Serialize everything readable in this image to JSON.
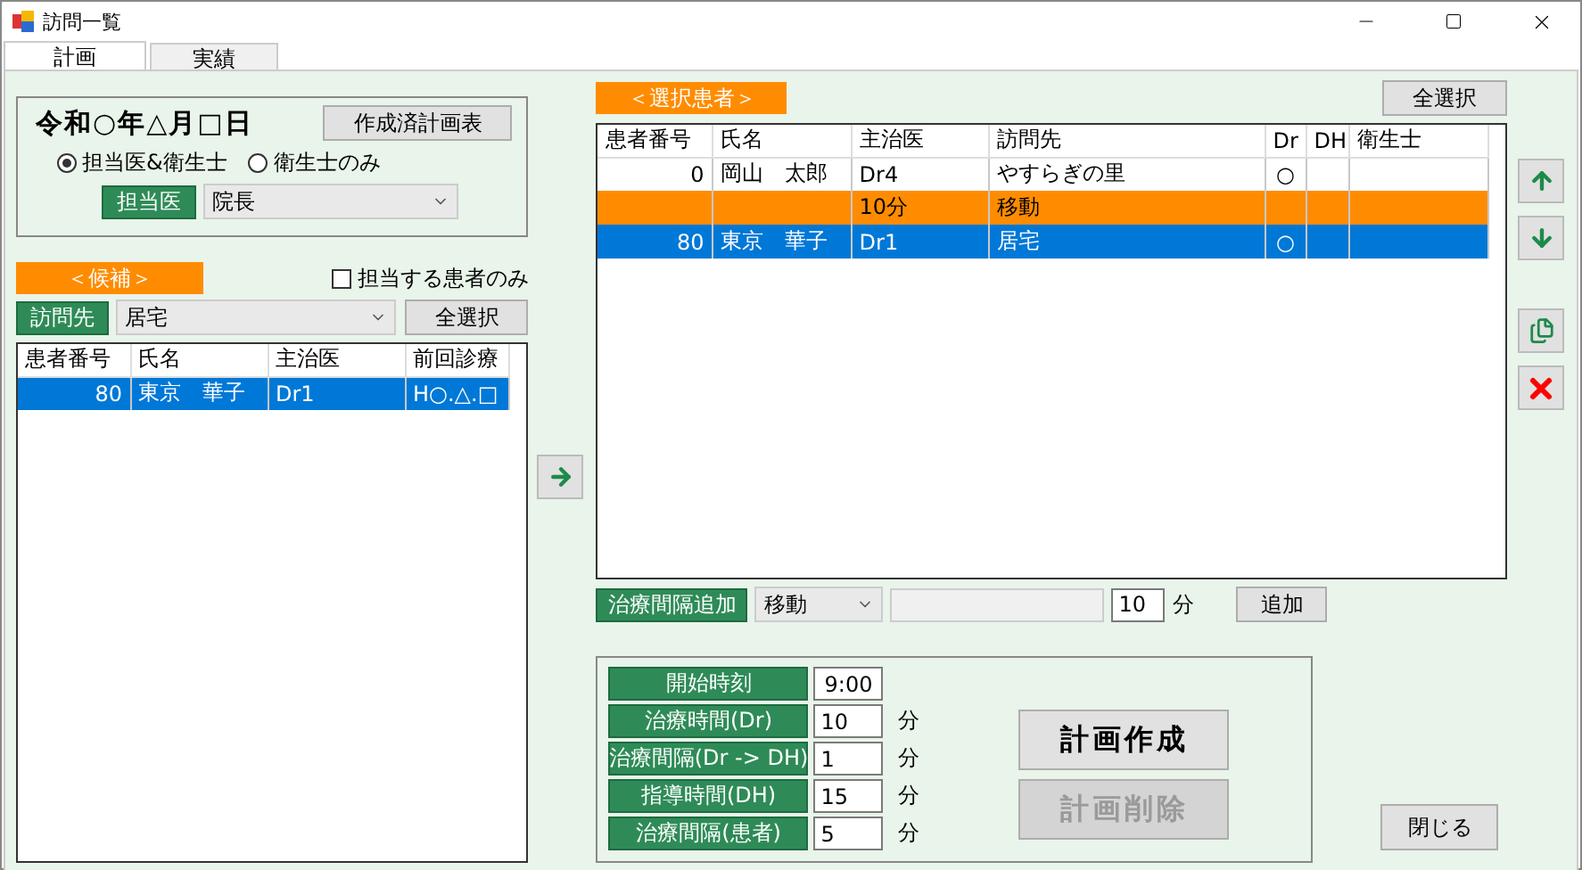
{
  "window": {
    "title": "訪問一覧"
  },
  "tabs": [
    {
      "label": "計画",
      "selected": true
    },
    {
      "label": "実績",
      "selected": false
    }
  ],
  "plan": {
    "date": "令和○年△月□日",
    "created_plans_button": "作成済計画表",
    "radios": [
      {
        "label": "担当医&衛生士",
        "selected": true
      },
      {
        "label": "衛生士のみ",
        "selected": false
      }
    ],
    "doctor_label": "担当医",
    "doctor_value": "院長"
  },
  "candidates": {
    "header": "＜候補＞",
    "only_mine": {
      "label": "担当する患者のみ",
      "checked": false
    },
    "visit_label": "訪問先",
    "visit_value": "居宅",
    "select_all": "全選択",
    "columns": [
      "患者番号",
      "氏名",
      "主治医",
      "前回診療"
    ],
    "rows": [
      {
        "selected": true,
        "cells": [
          "80",
          "東京　華子",
          "Dr1",
          "H○.△.□"
        ]
      }
    ]
  },
  "selected_patients": {
    "header": "＜選択患者＞",
    "select_all": "全選択",
    "columns": [
      "患者番号",
      "氏名",
      "主治医",
      "訪問先",
      "Dr",
      "DH",
      "衛生士"
    ],
    "rows": [
      {
        "kind": "patient",
        "selected": false,
        "cells": [
          "0",
          "岡山　太郎",
          "Dr4",
          "やすらぎの里",
          "○",
          "",
          ""
        ]
      },
      {
        "kind": "interval",
        "selected": false,
        "cells": [
          "",
          "",
          "10分",
          "移動",
          "",
          "",
          ""
        ]
      },
      {
        "kind": "patient",
        "selected": true,
        "cells": [
          "80",
          "東京　華子",
          "Dr1",
          "居宅",
          "○",
          "",
          ""
        ]
      }
    ]
  },
  "interval_add": {
    "label": "治療間隔追加",
    "type_value": "移動",
    "minutes": "10",
    "unit": "分",
    "button": "追加"
  },
  "settings": [
    {
      "label": "開始時刻",
      "value": "9:00"
    },
    {
      "label": "治療時間(Dr)",
      "value": "10",
      "unit": "分"
    },
    {
      "label": "治療間隔(Dr -> DH)",
      "value": "1",
      "unit": "分"
    },
    {
      "label": "指導時間(DH)",
      "value": "15",
      "unit": "分"
    },
    {
      "label": "治療間隔(患者)",
      "value": "5",
      "unit": "分"
    }
  ],
  "plan_buttons": [
    {
      "label": "計画作成",
      "disabled": false
    },
    {
      "label": "計画削除",
      "disabled": true
    }
  ],
  "close_button": "閉じる"
}
